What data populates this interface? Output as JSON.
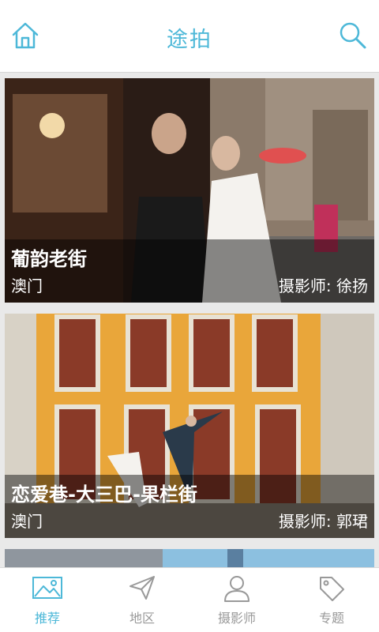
{
  "header": {
    "title": "途拍",
    "home_icon": "home-icon",
    "search_icon": "search-icon"
  },
  "cards": [
    {
      "place": "葡韵老街",
      "region": "澳门",
      "photographer": "摄影师: 徐扬"
    },
    {
      "place": "恋爱巷-大三巴-果栏街",
      "region": "澳门",
      "photographer": "摄影师: 郭珺"
    },
    {
      "place": "",
      "region": "",
      "photographer": ""
    }
  ],
  "tabs": [
    {
      "label": "推荐",
      "icon": "image-icon",
      "active": true
    },
    {
      "label": "地区",
      "icon": "paper-plane-icon",
      "active": false
    },
    {
      "label": "摄影师",
      "icon": "user-icon",
      "active": false
    },
    {
      "label": "专题",
      "icon": "tag-icon",
      "active": false
    }
  ],
  "colors": {
    "accent": "#4db8d8",
    "inactive": "#999999"
  }
}
